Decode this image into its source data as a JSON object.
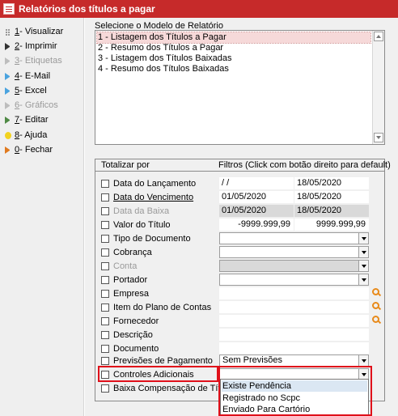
{
  "window": {
    "title": "Relatórios dos títulos a pagar"
  },
  "menu": [
    {
      "key": "1",
      "label": " - Visualizar",
      "icon": "play-gray-icon",
      "disabled": false
    },
    {
      "key": "2",
      "label": " - Imprimir",
      "icon": "play-dark-icon",
      "disabled": false
    },
    {
      "key": "3",
      "label": " - Etiquetas",
      "icon": "play-light-icon",
      "disabled": true
    },
    {
      "key": "4",
      "label": " - E-Mail",
      "icon": "play-blue-icon",
      "disabled": false
    },
    {
      "key": "5",
      "label": " - Excel",
      "icon": "play-blue-icon",
      "disabled": false
    },
    {
      "key": "6",
      "label": " - Gráficos",
      "icon": "play-light-icon",
      "disabled": true
    },
    {
      "key": "7",
      "label": " - Editar",
      "icon": "play-green-icon",
      "disabled": false
    },
    {
      "key": "8",
      "label": " - Ajuda",
      "icon": "bulb-icon",
      "disabled": false
    },
    {
      "key": "0",
      "label": " - Fechar",
      "icon": "play-orange-icon",
      "disabled": false
    }
  ],
  "models": {
    "label": "Selecione o Modelo de Relatório",
    "items": [
      "1 - Listagem dos Títulos a Pagar",
      "2 - Resumo dos Títulos a Pagar",
      "3 - Listagem dos Títulos Baixadas",
      "4 - Resumo dos Títulos Baixadas"
    ],
    "selected_index": 0
  },
  "filters": {
    "header_totalizar": "Totalizar por",
    "header_filtros": "Filtros (Click com botão direito para default)",
    "rows": {
      "data_lancamento": {
        "label": "Data do Lançamento",
        "from": " /  /",
        "to": "18/05/2020"
      },
      "data_vencimento": {
        "label": "Data do Vencimento",
        "from": "01/05/2020",
        "to": "18/05/2020"
      },
      "data_baixa": {
        "label": "Data da Baixa",
        "from": "01/05/2020",
        "to": "18/05/2020"
      },
      "valor_titulo": {
        "label": "Valor do Título",
        "from": "-9999.999,99",
        "to": "9999.999,99"
      },
      "tipo_documento": {
        "label": "Tipo de Documento"
      },
      "cobranca": {
        "label": "Cobrança"
      },
      "conta": {
        "label": "Conta"
      },
      "portador": {
        "label": "Portador"
      },
      "empresa": {
        "label": "Empresa"
      },
      "item_plano": {
        "label": "Item do Plano de Contas"
      },
      "fornecedor": {
        "label": "Fornecedor"
      },
      "descricao": {
        "label": "Descrição"
      },
      "documento": {
        "label": "Documento"
      },
      "previsoes": {
        "label": "Previsões de Pagamento",
        "value": "Sem Previsões"
      },
      "controles": {
        "label": "Controles Adicionais",
        "value": ""
      },
      "baixa_comp": {
        "label": "Baixa Compensação de Título"
      }
    },
    "dropdown_options": [
      "Existe Pendência",
      "Registrado no Scpc",
      "Enviado Para Cartório"
    ],
    "dropdown_highlighted": 0
  }
}
